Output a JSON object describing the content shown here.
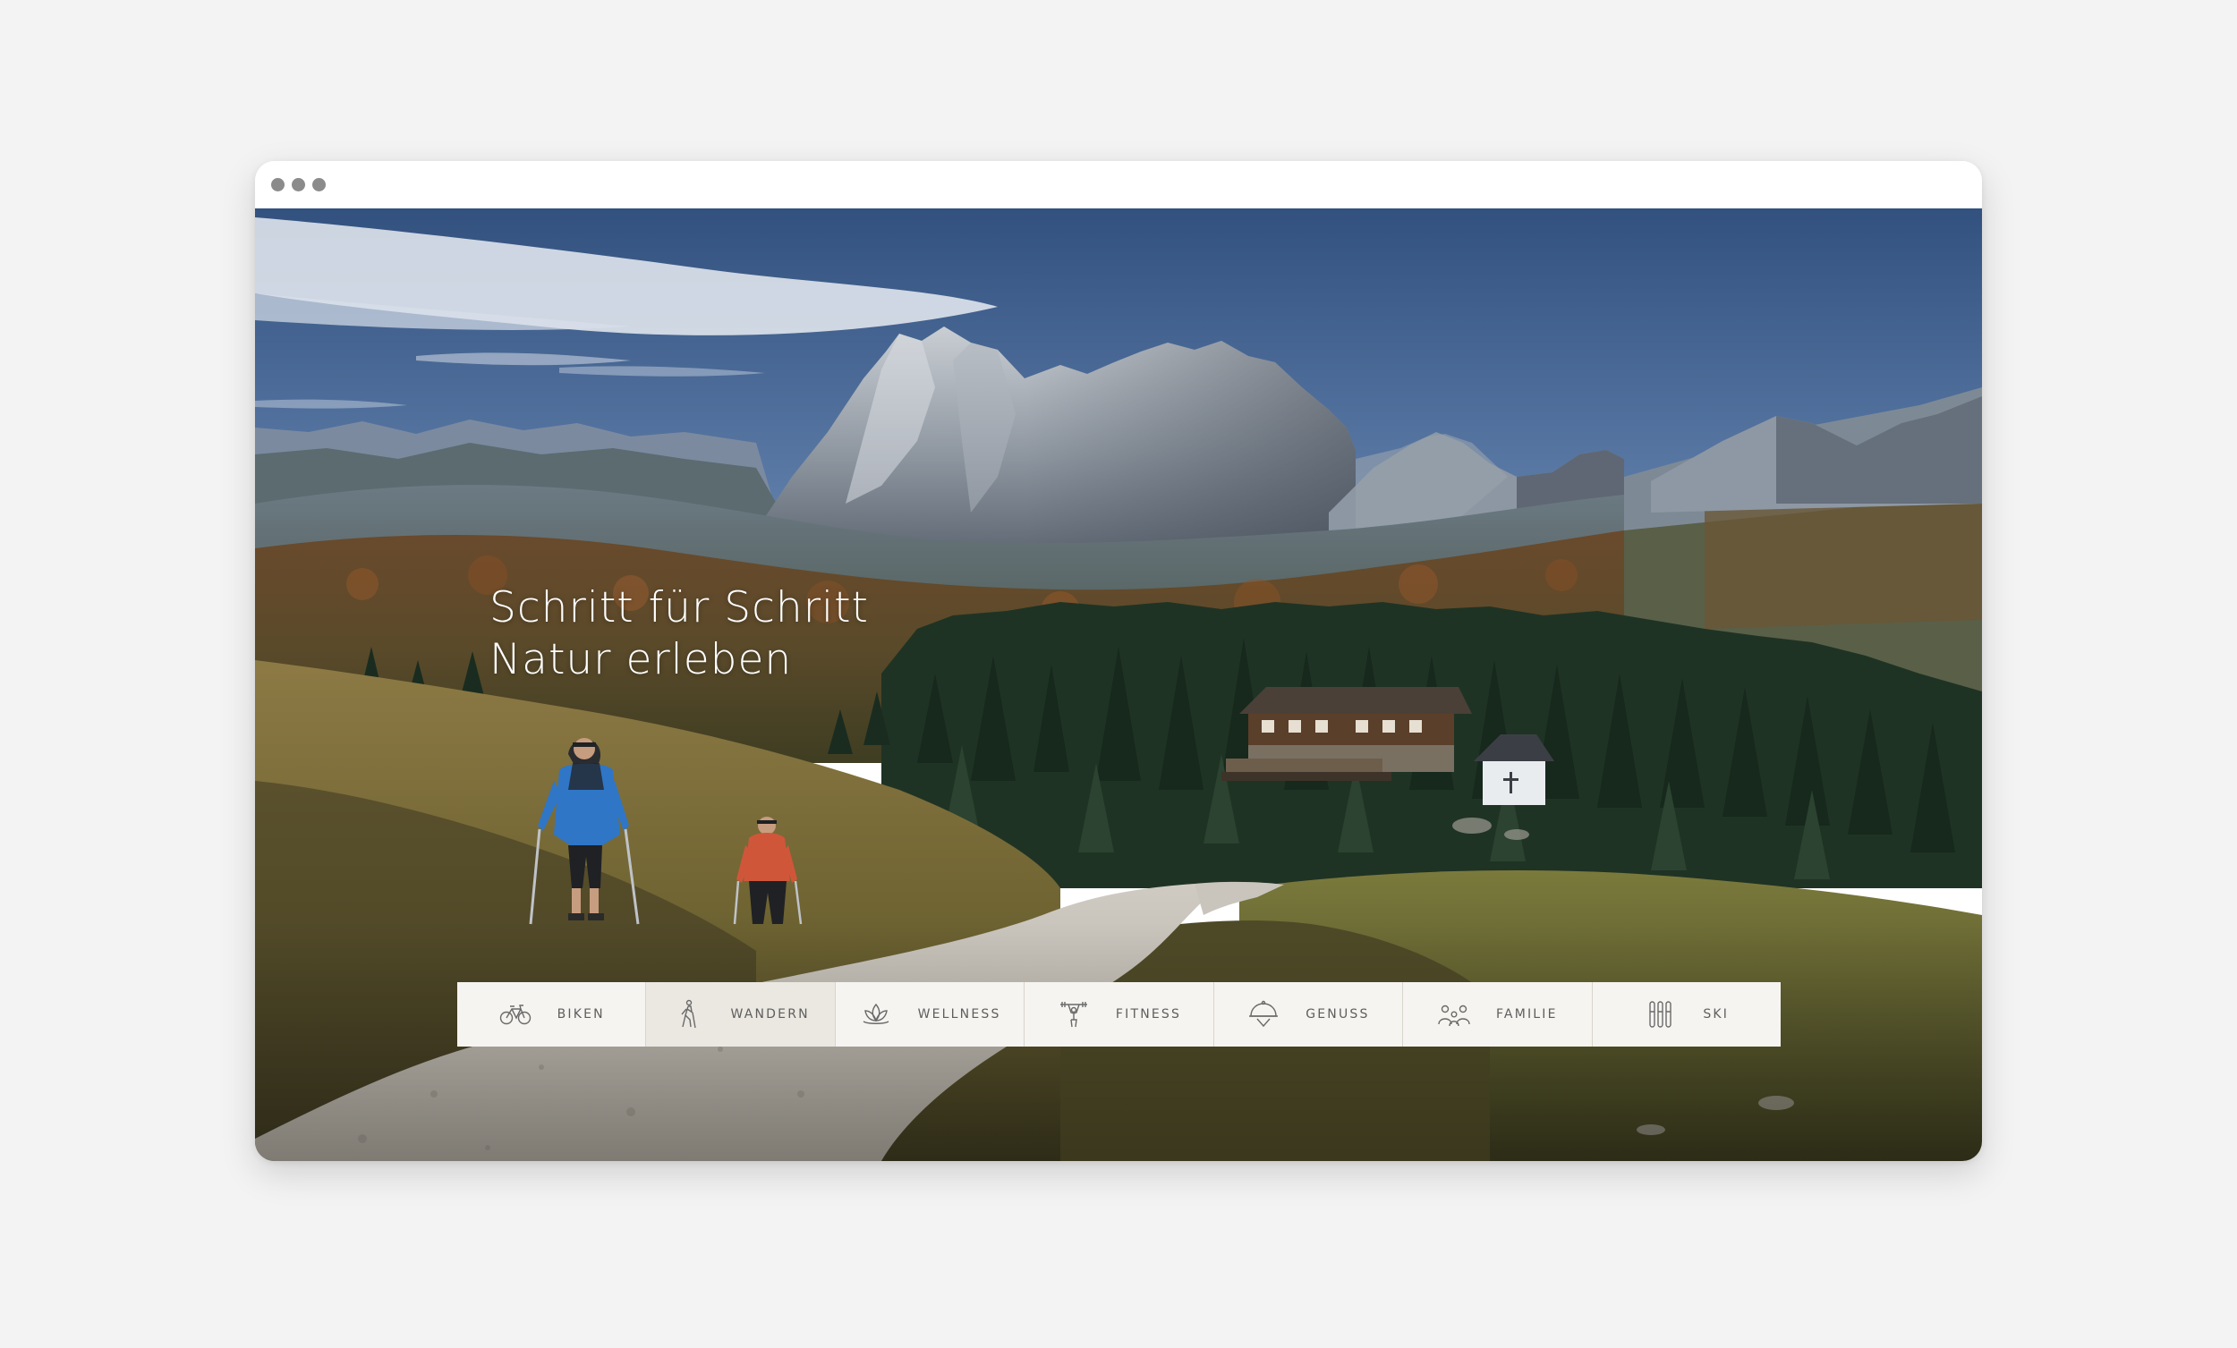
{
  "hero": {
    "headline_line1": "Schritt für Schritt",
    "headline_line2": "Natur erleben"
  },
  "nav": {
    "active": "wandern",
    "items": [
      {
        "id": "biken",
        "label": "BIKEN",
        "icon": "bicycle-icon"
      },
      {
        "id": "wandern",
        "label": "WANDERN",
        "icon": "hiker-icon"
      },
      {
        "id": "wellness",
        "label": "WELLNESS",
        "icon": "lotus-icon"
      },
      {
        "id": "fitness",
        "label": "FITNESS",
        "icon": "weightlifter-icon"
      },
      {
        "id": "genuss",
        "label": "GENUSS",
        "icon": "cloche-icon"
      },
      {
        "id": "familie",
        "label": "FAMILIE",
        "icon": "family-icon"
      },
      {
        "id": "ski",
        "label": "SKI",
        "icon": "skis-icon"
      }
    ]
  },
  "colors": {
    "nav_background": "#f6f4f0",
    "nav_active": "#ebe8e2",
    "nav_divider": "#d9d4cb",
    "page_background": "#f3f3f3"
  }
}
